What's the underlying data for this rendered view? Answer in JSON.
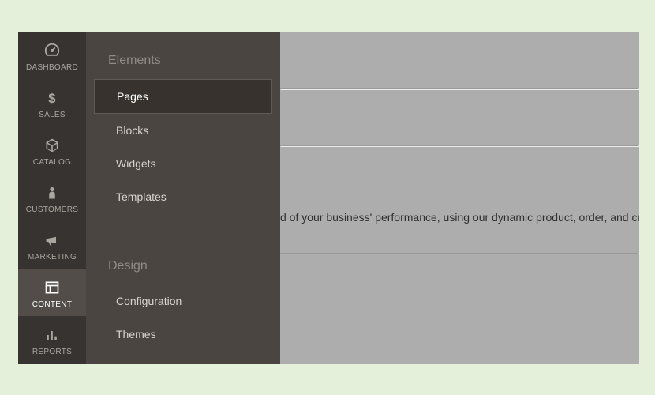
{
  "sidebar": {
    "items": [
      {
        "label": "DASHBOARD"
      },
      {
        "label": "SALES"
      },
      {
        "label": "CATALOG"
      },
      {
        "label": "CUSTOMERS"
      },
      {
        "label": "MARKETING"
      },
      {
        "label": "CONTENT"
      },
      {
        "label": "REPORTS"
      }
    ]
  },
  "submenu": {
    "groups": [
      {
        "title": "Elements",
        "items": [
          {
            "label": "Pages"
          },
          {
            "label": "Blocks"
          },
          {
            "label": "Widgets"
          },
          {
            "label": "Templates"
          }
        ]
      },
      {
        "title": "Design",
        "items": [
          {
            "label": "Configuration"
          },
          {
            "label": "Themes"
          }
        ]
      }
    ]
  },
  "main": {
    "text": "d of your business' performance, using our dynamic product, order, and cu"
  }
}
